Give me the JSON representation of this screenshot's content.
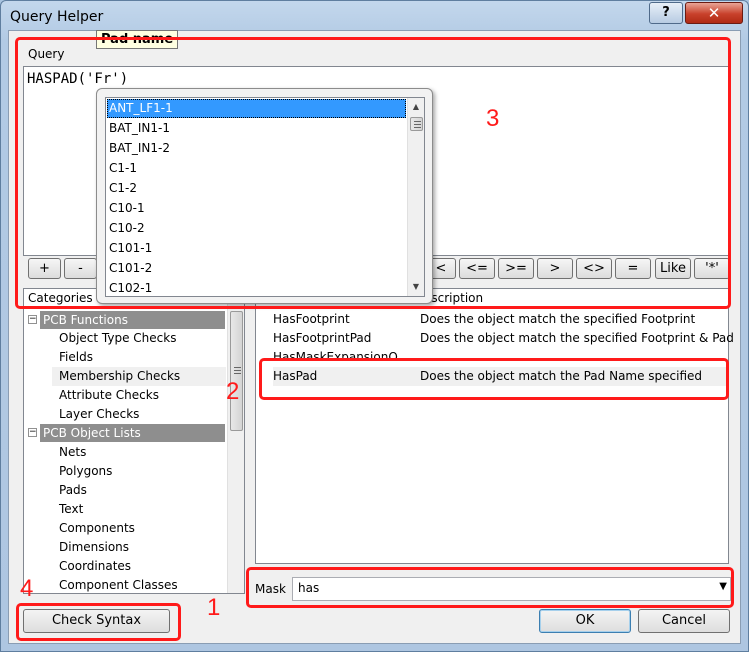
{
  "window": {
    "title": "Query Helper",
    "help_glyph": "?",
    "close_glyph": "✕"
  },
  "tooltip": "Pad name",
  "query": {
    "label": "Query",
    "text": "HASPAD('Fr')"
  },
  "autocomplete": {
    "items": [
      "ANT_LF1-1",
      "BAT_IN1-1",
      "BAT_IN1-2",
      "C1-1",
      "C1-2",
      "C10-1",
      "C10-2",
      "C101-1",
      "C101-2",
      "C102-1"
    ],
    "selected_index": 0
  },
  "operators": [
    "+",
    "-",
    "<",
    "<=",
    ">=",
    ">",
    "<>",
    "=",
    "Like",
    "'*'"
  ],
  "categories": {
    "header": "Categories",
    "items": [
      {
        "label": "PCB Functions",
        "type": "group",
        "expander": "⊟"
      },
      {
        "label": "Object Type Checks",
        "type": "leaf"
      },
      {
        "label": "Fields",
        "type": "leaf"
      },
      {
        "label": "Membership Checks",
        "type": "leaf",
        "highlighted": true
      },
      {
        "label": "Attribute Checks",
        "type": "leaf"
      },
      {
        "label": "Layer Checks",
        "type": "leaf"
      },
      {
        "label": "PCB Object Lists",
        "type": "group",
        "expander": "⊟"
      },
      {
        "label": "Nets",
        "type": "leaf"
      },
      {
        "label": "Polygons",
        "type": "leaf"
      },
      {
        "label": "Pads",
        "type": "leaf"
      },
      {
        "label": "Text",
        "type": "leaf"
      },
      {
        "label": "Components",
        "type": "leaf"
      },
      {
        "label": "Dimensions",
        "type": "leaf"
      },
      {
        "label": "Coordinates",
        "type": "leaf"
      },
      {
        "label": "Component Classes",
        "type": "leaf"
      }
    ]
  },
  "functions": {
    "header_desc": "escription",
    "rows": [
      {
        "name": "HasFootprint",
        "desc": "Does the object match the specified Footprint"
      },
      {
        "name": "HasFootprintPad",
        "desc": "Does the object match the specified Footprint & Pad"
      },
      {
        "name": "HasMaskExpansionO",
        "desc": ""
      },
      {
        "name": "HasPad",
        "desc": "Does the object match the Pad Name specified",
        "selected": true
      }
    ]
  },
  "mask": {
    "label": "Mask",
    "value": "has"
  },
  "buttons": {
    "check_syntax": "Check Syntax",
    "ok": "OK",
    "cancel": "Cancel"
  },
  "annotations": [
    "1",
    "2",
    "3",
    "4"
  ],
  "colors": {
    "annotation": "#ff1a1a",
    "selection": "#3399ff",
    "group_bg": "#8e8e8e"
  }
}
